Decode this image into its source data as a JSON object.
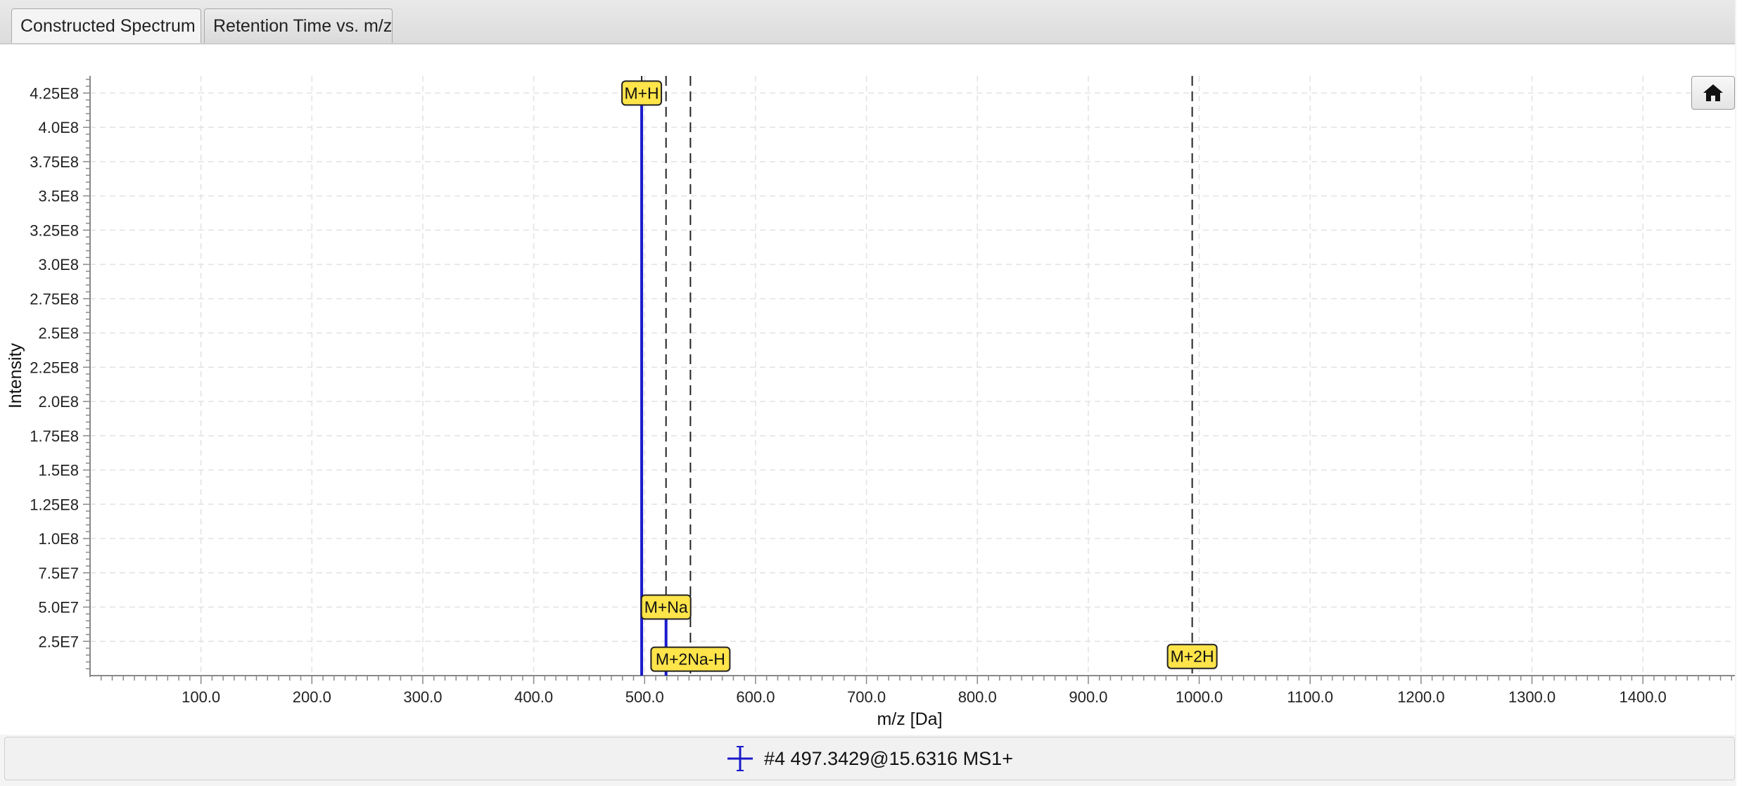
{
  "tabs": [
    {
      "label": "Constructed Spectrum",
      "active": true
    },
    {
      "label": "Retention Time vs. m/z",
      "active": false
    }
  ],
  "status": {
    "text": "#4 497.3429@15.6316 MS1+",
    "icon": "crosshair-icon"
  },
  "home_button": {
    "icon": "home-icon"
  },
  "colors": {
    "peak": "#1a1acc",
    "annotation_bg": "#ffe44a",
    "grid": "#e2e2e2"
  },
  "chart_data": {
    "type": "bar",
    "xlabel": "m/z [Da]",
    "ylabel": "Intensity",
    "xlim": [
      0,
      1483
    ],
    "ylim": [
      0,
      437500000
    ],
    "x_ticks": [
      100,
      200,
      300,
      400,
      500,
      600,
      700,
      800,
      900,
      1000,
      1100,
      1200,
      1300,
      1400
    ],
    "x_tick_labels": [
      "100.0",
      "200.0",
      "300.0",
      "400.0",
      "500.0",
      "600.0",
      "700.0",
      "800.0",
      "900.0",
      "1000.0",
      "1100.0",
      "1200.0",
      "1300.0",
      "1400.0"
    ],
    "y_ticks": [
      25000000,
      50000000,
      75000000,
      100000000,
      125000000,
      150000000,
      175000000,
      200000000,
      225000000,
      250000000,
      275000000,
      300000000,
      325000000,
      350000000,
      375000000,
      400000000,
      425000000
    ],
    "y_tick_labels": [
      "2.5E7",
      "5.0E7",
      "7.5E7",
      "1.0E8",
      "1.25E8",
      "1.5E8",
      "1.75E8",
      "2.0E8",
      "2.25E8",
      "2.5E8",
      "2.75E8",
      "3.0E8",
      "3.25E8",
      "3.5E8",
      "3.75E8",
      "4.0E8",
      "4.25E8"
    ],
    "grid": true,
    "peaks": [
      {
        "mz": 497.34,
        "intensity": 425000000
      },
      {
        "mz": 519.3,
        "intensity": 50000000
      }
    ],
    "adduct_markers": [
      {
        "mz": 497.34,
        "label": "M+H",
        "label_intensity": 425000000
      },
      {
        "mz": 519.3,
        "label": "M+Na",
        "label_intensity": 50000000
      },
      {
        "mz": 541.3,
        "label": "M+2Na-H",
        "label_intensity": 12000000
      },
      {
        "mz": 993.7,
        "label": "M+2H",
        "label_intensity": 14000000
      }
    ]
  }
}
